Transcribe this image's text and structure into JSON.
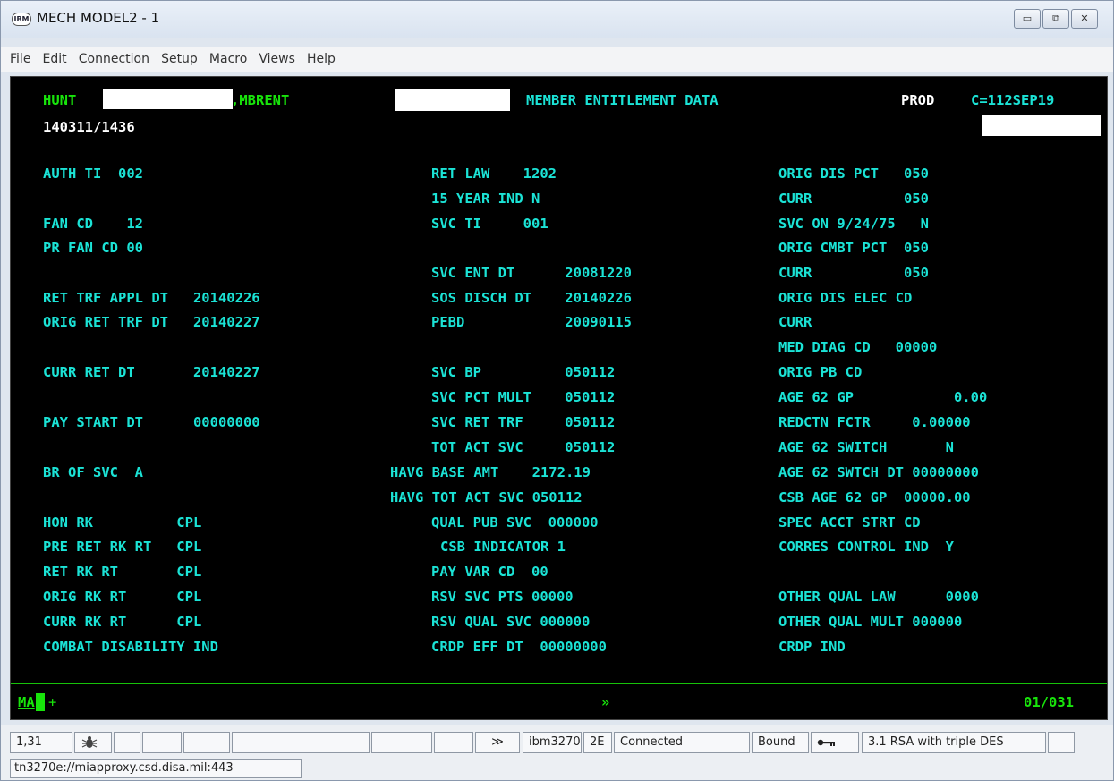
{
  "window": {
    "title": "MECH MODEL2 - 1",
    "icon_text": "IBM",
    "controls": {
      "minimize": "▭",
      "restore": "⧉",
      "close": "✕"
    }
  },
  "menu": [
    "File",
    "Edit",
    "Connection",
    "Setup",
    "Macro",
    "Views",
    "Help"
  ],
  "screen": {
    "header": {
      "hunt": "HUNT",
      "mbrent": ",MBRENT",
      "title": "MEMBER ENTITLEMENT DATA",
      "prod": "PROD",
      "c_date": "C=112SEP19",
      "timestamp": "140311/1436"
    },
    "col1": {
      "auth_ti": "AUTH TI  002",
      "fan_cd": "FAN CD    12",
      "pr_fan_cd": "PR FAN CD 00",
      "ret_trf_appl_dt": "RET TRF APPL DT   20140226",
      "orig_ret_trf_dt": "ORIG RET TRF DT   20140227",
      "curr_ret_dt": "CURR RET DT       20140227",
      "pay_start_dt": "PAY START DT      00000000",
      "br_of_svc": "BR OF SVC  A",
      "hon_rk": "HON RK          CPL",
      "pre_ret_rk_rt": "PRE RET RK RT   CPL",
      "ret_rk_rt": "RET RK RT       CPL",
      "orig_rk_rt": "ORIG RK RT      CPL",
      "curr_rk_rt": "CURR RK RT      CPL",
      "combat_disability_ind": "COMBAT DISABILITY IND"
    },
    "col2": {
      "ret_law": "RET LAW    1202",
      "year_ind": "15 YEAR IND N",
      "svc_ti": "SVC TI     001",
      "svc_ent_dt": "SVC ENT DT      20081220",
      "sos_disch_dt": "SOS DISCH DT    20140226",
      "pebd": "PEBD            20090115",
      "svc_bp": "SVC BP          050112",
      "svc_pct_mult": "SVC PCT MULT    050112",
      "svc_ret_trf": "SVC RET TRF     050112",
      "tot_act_svc": "TOT ACT SVC     050112",
      "havg_base_amt": "HAVG BASE AMT    2172.19",
      "havg_tot_act_svc": "HAVG TOT ACT SVC 050112",
      "qual_pub_svc": "QUAL PUB SVC  000000",
      "csb_indicator": "CSB INDICATOR 1",
      "pay_var_cd": "PAY VAR CD  00",
      "rsv_svc_pts": "RSV SVC PTS 00000",
      "rsv_qual_svc": "RSV QUAL SVC 000000",
      "crdp_eff_dt": "CRDP EFF DT  00000000"
    },
    "col3": {
      "orig_dis_pct": "ORIG DIS PCT   050",
      "curr_1": "CURR           050",
      "svc_on": "SVC ON 9/24/75   N",
      "orig_cmbt_pct": "ORIG CMBT PCT  050",
      "curr_2": "CURR           050",
      "orig_dis_elec_cd": "ORIG DIS ELEC CD",
      "curr_3": "CURR",
      "med_diag_cd": "MED DIAG CD   00000",
      "orig_pb_cd": "ORIG PB CD",
      "age_62_gp": "AGE 62 GP            0.00",
      "redctn_fctr": "REDCTN FCTR     0.00000",
      "age_62_switch": "AGE 62 SWITCH       N",
      "age_62_swtch_dt": "AGE 62 SWTCH DT 00000000",
      "csb_age_62_gp": "CSB AGE 62 GP  00000.00",
      "spec_acct_strt_cd": "SPEC ACCT STRT CD",
      "corres_control_ind": "CORRES CONTROL IND  Y",
      "other_qual_law": "OTHER QUAL LAW      0000",
      "other_qual_mult": "OTHER QUAL MULT 000000",
      "crdp_ind": "CRDP IND"
    },
    "oia": {
      "ma": "MA",
      "plus": "+",
      "arrow": "»",
      "page": "01/031"
    }
  },
  "statusbar": {
    "cursor_pos": "1,31",
    "bug_icon": "bug-icon",
    "arrow": "≫",
    "terminal_type": "ibm3270",
    "model": "2E",
    "connection": "Connected",
    "bound": "Bound",
    "key_icon": "key-icon",
    "encryption": "3.1 RSA with triple DES",
    "url": "tn3270e://miapproxy.csd.disa.mil:443"
  }
}
